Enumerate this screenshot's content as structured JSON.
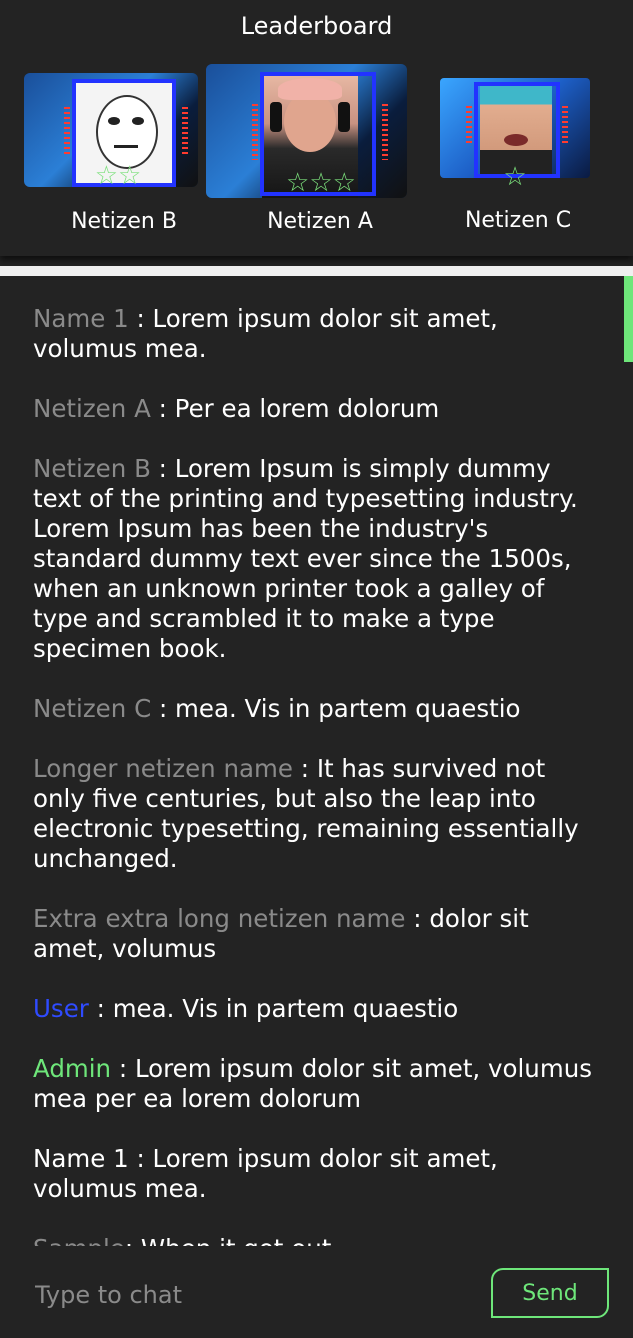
{
  "leaderboard": {
    "title": "Leaderboard",
    "entries": [
      {
        "name": "Netizen B",
        "stars": "☆☆"
      },
      {
        "name": "Netizen A",
        "stars": "☆☆☆"
      },
      {
        "name": "Netizen C",
        "stars": "☆"
      }
    ]
  },
  "chat": {
    "messages": [
      {
        "name": "Name 1",
        "separator": " : ",
        "text": "Lorem ipsum dolor sit amet, volumus mea."
      },
      {
        "name": "Netizen A",
        "separator": " : ",
        "text": "Per ea lorem dolorum"
      },
      {
        "name": "Netizen B",
        "separator": " : ",
        "text": "Lorem Ipsum is simply dummy text of the printing and typesetting industry. Lorem Ipsum has been the industry's standard dummy text ever since the 1500s, when an unknown printer took a galley of type and scrambled it to make a type specimen book."
      },
      {
        "name": "Netizen C",
        "separator": " : ",
        "text": "mea. Vis in partem quaestio"
      },
      {
        "name": "Longer netizen name",
        "separator": " : ",
        "text": "It has survived not only five centuries, but also the leap into electronic typesetting, remaining essentially unchanged."
      },
      {
        "name": "Extra extra long netizen name",
        "separator": " : ",
        "text": "dolor sit amet, volumus"
      },
      {
        "name": "User",
        "separator": " : ",
        "text": "mea. Vis in partem quaestio"
      },
      {
        "name": "Admin",
        "separator": " : ",
        "text": "Lorem ipsum dolor sit amet, volumus mea per ea lorem dolorum"
      },
      {
        "name": "Name 1",
        "separator": " : ",
        "text": "Lorem ipsum dolor sit amet, volumus mea."
      },
      {
        "name": "Sample",
        "separator": ": ",
        "text": "When it got out"
      }
    ]
  },
  "input": {
    "placeholder": "Type to chat",
    "send_label": "Send"
  },
  "colors": {
    "accent_green": "#6ee67a",
    "user_blue": "#2f4bff",
    "name_gray": "#8a8a8a",
    "background": "#232323"
  }
}
